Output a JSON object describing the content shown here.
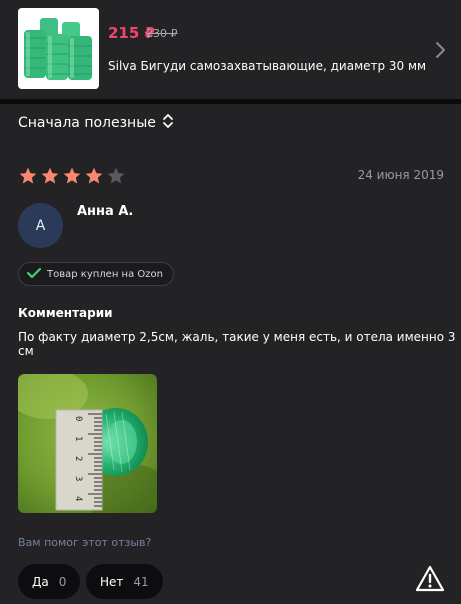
{
  "product": {
    "price": "215 ₽",
    "old_price": "230 ₽",
    "title": "Silva Бигуди самозахватывающие, диаметр 30 мм"
  },
  "sort": {
    "label": "Сначала полезные"
  },
  "review": {
    "rating": 4,
    "rating_max": 5,
    "date": "24 июня 2019",
    "author_initial": "A",
    "author": "Анна А.",
    "verified_badge": "Товар куплен на Ozon",
    "comment_heading": "Комментарии",
    "comment": "По факту диаметр 2,5см, жаль, такие у меня есть, и отела именно 3 см",
    "photo_ruler_digits": [
      "0",
      "1",
      "2",
      "3",
      "4"
    ]
  },
  "feedback": {
    "question": "Вам помог этот отзыв?",
    "yes_label": "Да",
    "yes_count": "0",
    "no_label": "Нет",
    "no_count": "41"
  },
  "colors": {
    "background": "#232325",
    "price": "#f0466e",
    "star_filled": "#f9886f",
    "star_empty": "#5a5a5e",
    "avatar": "#2c3a5a",
    "verified_check": "#3cd37a",
    "helpful_text": "#74809c"
  },
  "icons": [
    "chevron-right-icon",
    "sort-arrows-icon",
    "star-icon",
    "check-icon",
    "report-warning-icon"
  ]
}
